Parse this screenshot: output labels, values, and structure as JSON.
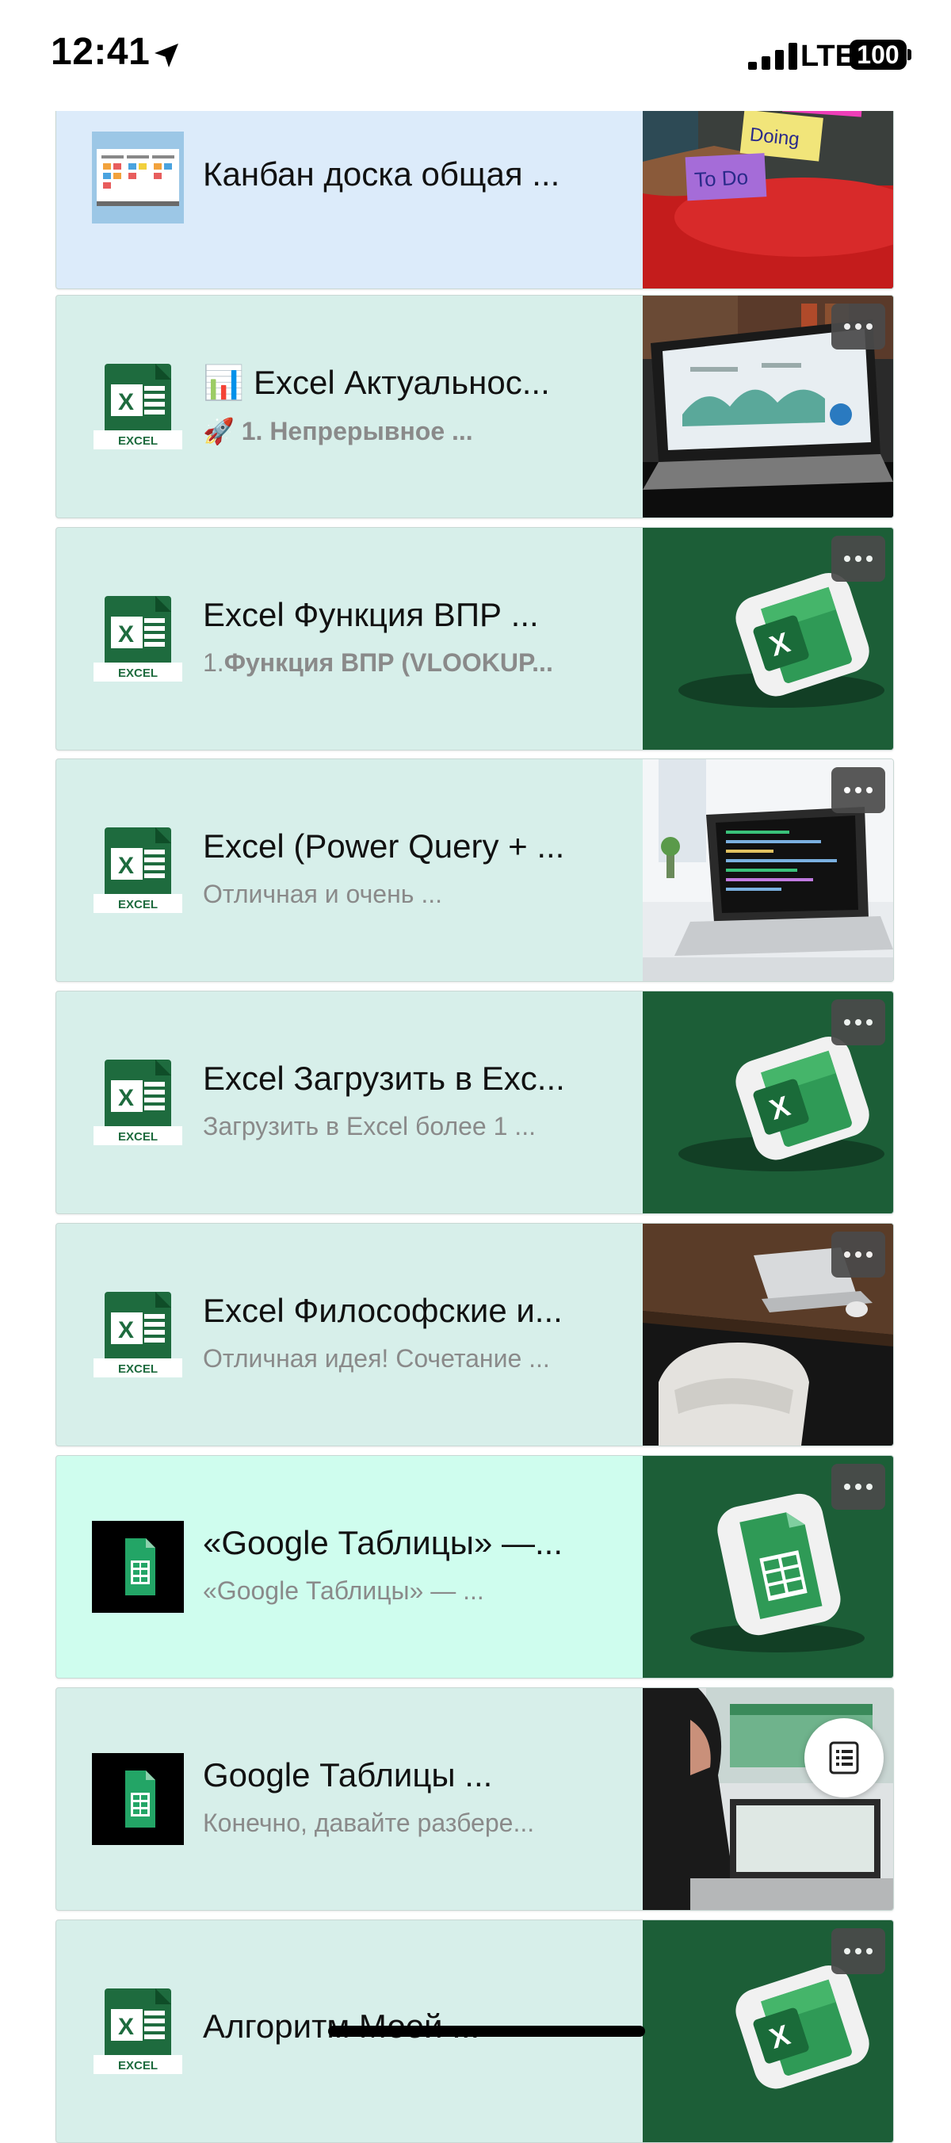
{
  "status_bar": {
    "time": "12:41",
    "network": "LTE",
    "battery": "100"
  },
  "colors": {
    "card_blue": "#dcebfa",
    "card_teal": "#d7efea",
    "card_mint": "#cffdee",
    "excel_green": "#1e6b3e",
    "image_dark_green": "#1c5e37"
  },
  "cards": [
    {
      "icon": "kanban-board-icon",
      "title": "Канбан доска общая ...",
      "subtitle": "",
      "image": "sticky-notes-photo"
    },
    {
      "icon": "excel-icon",
      "title_emoji": "📊",
      "title": "Excel Актуальнос...",
      "subtitle_emoji": "🚀",
      "subtitle": "1. Непрерывное ...",
      "image": "laptop-dashboard-photo"
    },
    {
      "icon": "excel-icon",
      "title": "Excel Функция ВПР ...",
      "subtitle_prefix": "1.",
      "subtitle": "Функция ВПР (VLOOKUP...",
      "image": "excel-3d-logo"
    },
    {
      "icon": "excel-icon",
      "title": "Excel (Power Query + ...",
      "subtitle": "Отличная и очень ...",
      "image": "laptop-code-photo"
    },
    {
      "icon": "excel-icon",
      "title": "Excel Загрузить в Exc...",
      "subtitle": "Загрузить в Excel более 1 ...",
      "image": "excel-3d-logo"
    },
    {
      "icon": "excel-icon",
      "title": "Excel Философские и...",
      "subtitle": "Отличная идея! Сочетание ...",
      "image": "desk-chair-photo"
    },
    {
      "icon": "google-sheets-icon",
      "title": "«Google Таблицы» —...",
      "subtitle": "«Google Таблицы» — ...",
      "image": "sheets-3d-logo"
    },
    {
      "icon": "google-sheets-icon",
      "title": "Google Таблицы ...",
      "subtitle": "Конечно, давайте разбере...",
      "image": "woman-at-computer-photo"
    },
    {
      "icon": "excel-icon",
      "title": "Алгоритм Моей ...",
      "subtitle": "",
      "image": "excel-3d-logo"
    }
  ]
}
